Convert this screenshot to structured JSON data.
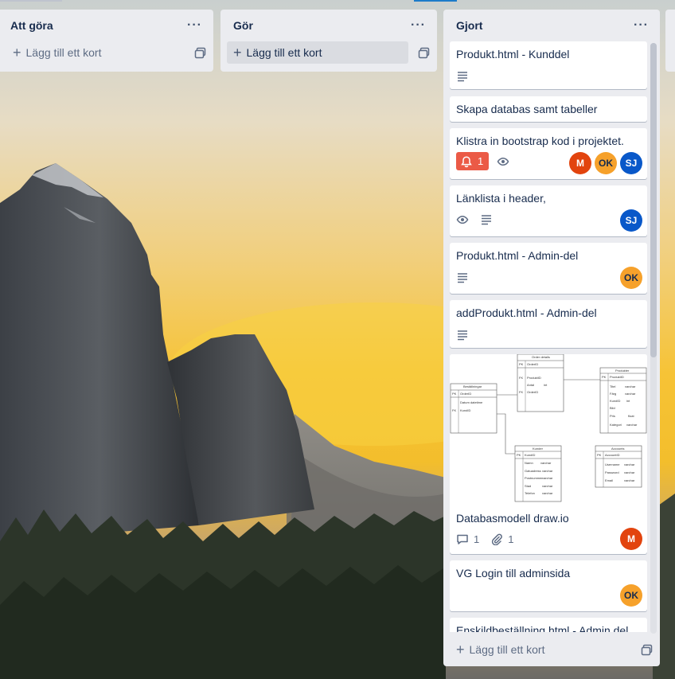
{
  "board": {
    "lists": [
      {
        "title": "Att göra",
        "add_card_label": "Lägg till ett kort"
      },
      {
        "title": "Gör",
        "add_card_label": "Lägg till ett kort"
      },
      {
        "title": "Gjort",
        "add_card_label": "Lägg till ett kort",
        "cards": [
          {
            "title": "Produkt.html - Kunddel",
            "badges": [
              "description-icon"
            ]
          },
          {
            "title": "Skapa databas samt tabeller"
          },
          {
            "title": "Klistra in bootstrap kod i projektet.",
            "alert_count": "1",
            "badges": [
              "bell-icon",
              "eye-icon"
            ],
            "members": [
              "M",
              "OK",
              "SJ"
            ]
          },
          {
            "title": "Länklista i header,",
            "badges": [
              "eye-icon",
              "description-icon"
            ],
            "members": [
              "SJ"
            ]
          },
          {
            "title": "Produkt.html - Admin-del",
            "badges": [
              "description-icon"
            ],
            "members": [
              "OK"
            ]
          },
          {
            "title": "addProdukt.html - Admin-del",
            "badges": [
              "description-icon"
            ]
          },
          {
            "title": "Databasmodell draw.io",
            "comments": "1",
            "attachments": "1",
            "members": [
              "M"
            ],
            "cover": {
              "tables": [
                {
                  "name": "Order details",
                  "rows": [
                    "OrderID",
                    "ProduktID",
                    "Antal",
                    "OrderID"
                  ]
                },
                {
                  "name": "Produkter",
                  "rows": [
                    "ProduktID",
                    "Titel",
                    "Färg",
                    "KundID",
                    "Bild",
                    "Pris",
                    "Kategori"
                  ]
                },
                {
                  "name": "Beställningar",
                  "rows": [
                    "OrderID",
                    "Datum datetime",
                    "KundID"
                  ]
                },
                {
                  "name": "Kunder",
                  "rows": [
                    "KundID",
                    "Namn",
                    "Gatuadress",
                    "Postnummer",
                    "Stad",
                    "Telefon"
                  ]
                },
                {
                  "name": "Accounts",
                  "rows": [
                    "AccountID",
                    "Username",
                    "Password",
                    "Email"
                  ]
                }
              ]
            }
          },
          {
            "title": "VG Login till adminsida",
            "members": [
              "OK"
            ]
          },
          {
            "title": "Enskildbeställning.html - Admin del"
          }
        ]
      }
    ]
  },
  "members": {
    "M": {
      "initials": "M",
      "color": "#e2440e"
    },
    "OK": {
      "initials": "OK",
      "color": "#f6a12b"
    },
    "SJ": {
      "initials": "SJ",
      "color": "#0958c9"
    }
  },
  "colors": {
    "list_bg": "#ebecf0",
    "alert_red": "#eb5a46",
    "text": "#172b4d",
    "muted": "#5e6c84"
  }
}
